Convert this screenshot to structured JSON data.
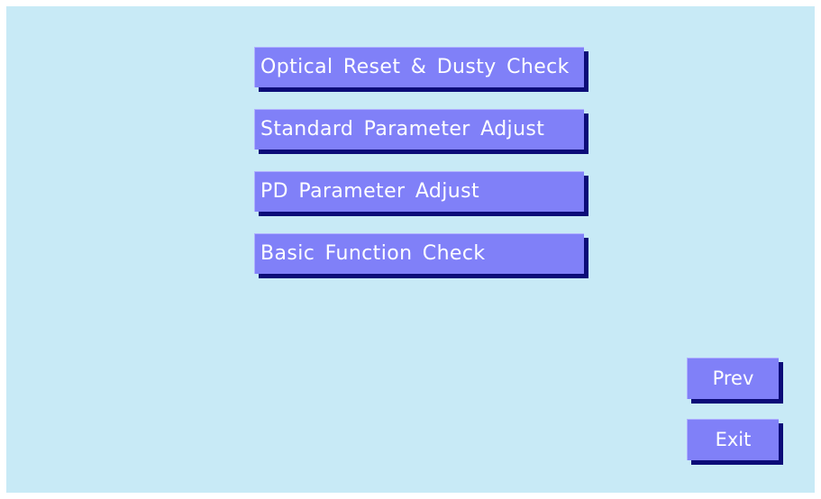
{
  "menu": {
    "items": [
      {
        "label": "Optical Reset & Dusty Check"
      },
      {
        "label": "Standard Parameter Adjust"
      },
      {
        "label": "PD Parameter Adjust"
      },
      {
        "label": "Basic Function Check"
      }
    ]
  },
  "navigation": {
    "prev_label": "Prev",
    "exit_label": "Exit"
  },
  "colors": {
    "background": "#c8eaf6",
    "button_face": "#8080f8",
    "button_shadow": "#0c0c78",
    "button_text": "#ffffff"
  }
}
